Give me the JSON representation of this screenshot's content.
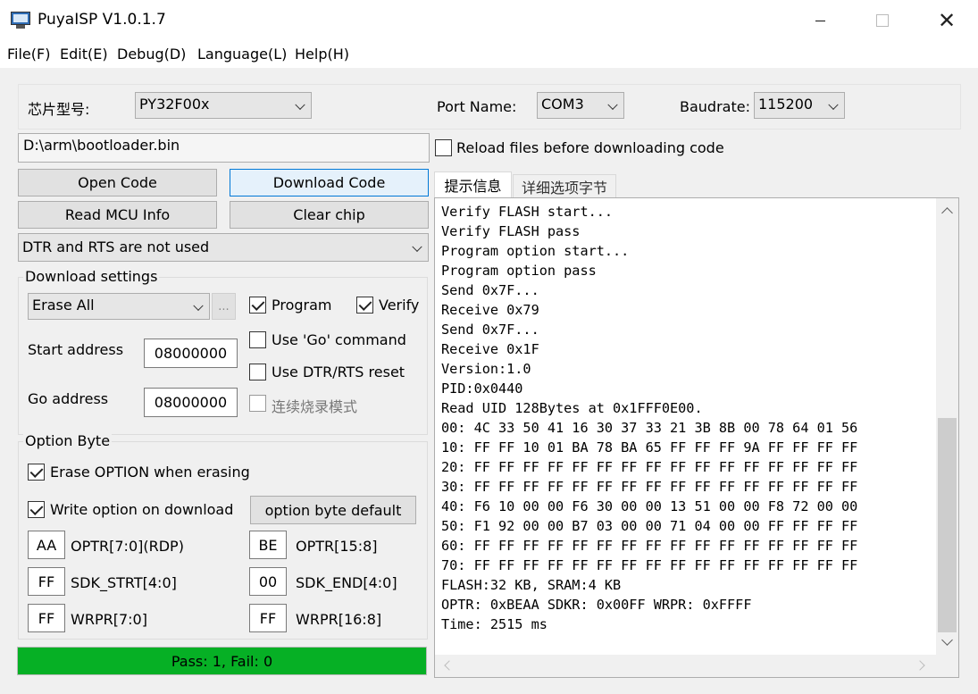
{
  "window": {
    "title": "PuyaISP V1.0.1.7",
    "icon": "isp-monitor-icon"
  },
  "menu": {
    "file": "File(F)",
    "edit": "Edit(E)",
    "debug": "Debug(D)",
    "language": "Language(L)",
    "help": "Help(H)"
  },
  "top": {
    "chip_label": "芯片型号:",
    "chip_value": "PY32F00x",
    "port_label": "Port Name:",
    "port_value": "COM3",
    "baud_label": "Baudrate:",
    "baud_value": "115200"
  },
  "file": {
    "path": "D:\\arm\\bootloader.bin",
    "reload_label": "Reload files before downloading code",
    "reload_checked": false
  },
  "buttons": {
    "open_code": "Open Code",
    "download_code": "Download Code",
    "read_mcu_info": "Read MCU Info",
    "clear_chip": "Clear chip"
  },
  "dtr_rts": {
    "value": "DTR and RTS are not used"
  },
  "download_settings": {
    "title": "Download settings",
    "erase_value": "Erase All",
    "ellipsis": "...",
    "program_label": "Program",
    "program_checked": true,
    "verify_label": "Verify",
    "verify_checked": true,
    "start_address_label": "Start address",
    "start_address_value": "08000000",
    "go_address_label": "Go address",
    "go_address_value": "08000000",
    "use_go_label": "Use 'Go' command",
    "use_go_checked": false,
    "use_dtr_label": "Use DTR/RTS reset",
    "use_dtr_checked": false,
    "continuous_label": "连续烧录模式",
    "continuous_checked": false
  },
  "option_byte": {
    "title": "Option Byte",
    "erase_option_label": "Erase OPTION when erasing",
    "erase_option_checked": true,
    "write_option_label": "Write option on download",
    "write_option_checked": true,
    "default_button": "option byte default",
    "optr_low_value": "AA",
    "optr_low_label": "OPTR[7:0](RDP)",
    "optr_high_value": "BE",
    "optr_high_label": "OPTR[15:8]",
    "sdk_strt_value": "FF",
    "sdk_strt_label": "SDK_STRT[4:0]",
    "sdk_end_value": "00",
    "sdk_end_label": "SDK_END[4:0]",
    "wrpr_low_value": "FF",
    "wrpr_low_label": "WRPR[7:0]",
    "wrpr_high_value": "FF",
    "wrpr_high_label": "WRPR[16:8]"
  },
  "status": {
    "text": "Pass: 1, Fail: 0",
    "color": "#06b025"
  },
  "tabs": {
    "info": "提示信息",
    "details": "详细选项字节"
  },
  "log": {
    "lines": [
      "Verify FLASH start...",
      "Verify FLASH pass",
      "Program option start...",
      "Program option pass",
      "Send 0x7F...",
      "Receive 0x79",
      "Send 0x7F...",
      "Receive 0x1F",
      "Version:1.0",
      "PID:0x0440",
      "Read UID 128Bytes at 0x1FFF0E00.",
      "00: 4C 33 50 41 16 30 37 33 21 3B 8B 00 78 64 01 56",
      "10: FF FF 10 01 BA 78 BA 65 FF FF FF 9A FF FF FF FF",
      "20: FF FF FF FF FF FF FF FF FF FF FF FF FF FF FF FF",
      "30: FF FF FF FF FF FF FF FF FF FF FF FF FF FF FF FF",
      "40: F6 10 00 00 F6 30 00 00 13 51 00 00 F8 72 00 00",
      "50: F1 92 00 00 B7 03 00 00 71 04 00 00 FF FF FF FF",
      "60: FF FF FF FF FF FF FF FF FF FF FF FF FF FF FF FF",
      "70: FF FF FF FF FF FF FF FF FF FF FF FF FF FF FF FF",
      "FLASH:32 KB, SRAM:4 KB",
      "OPTR: 0xBEAA SDKR: 0x00FF WRPR: 0xFFFF",
      "Time: 2515 ms"
    ]
  }
}
